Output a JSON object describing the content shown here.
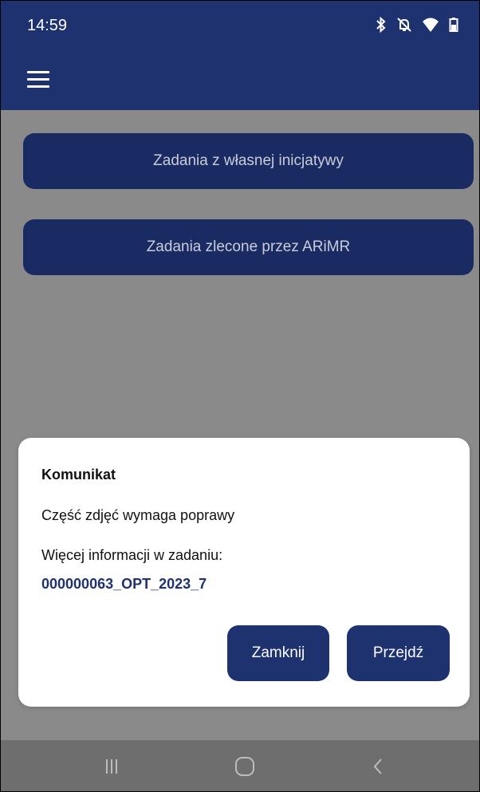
{
  "status_bar": {
    "time": "14:59",
    "icons": [
      "bluetooth-icon",
      "muted-bell-icon",
      "wifi-icon",
      "battery-icon"
    ]
  },
  "app_bar": {
    "menu_icon": "hamburger-menu-icon"
  },
  "main": {
    "buttons": [
      {
        "label": "Zadania z własnej inicjatywy"
      },
      {
        "label": "Zadania zlecone przez ARiMR"
      }
    ]
  },
  "dialog": {
    "title": "Komunikat",
    "message": "Część zdjęć wymaga poprawy",
    "info_label": "Więcej informacji w zadaniu:",
    "task_link": "000000063_OPT_2023_7",
    "close_label": "Zamknij",
    "go_label": "Przejdź"
  },
  "nav_bar": {
    "items": [
      "recent-apps-icon",
      "home-icon",
      "back-icon"
    ]
  },
  "colors": {
    "primary": "#1f3270",
    "button_dimmed": "#1a2b63",
    "scrim_background": "#8a8a8a",
    "nav_background": "#6e6e6e",
    "dialog_background": "#ffffff"
  }
}
